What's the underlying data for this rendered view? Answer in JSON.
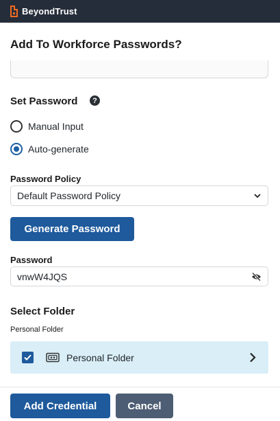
{
  "brand": {
    "name": "BeyondTrust",
    "logo_icon": "beyondtrust-logo-icon",
    "accent": "#f26b21"
  },
  "dialog": {
    "title": "Add To Workforce Passwords?"
  },
  "set_password": {
    "title": "Set Password",
    "help_icon": "?",
    "options": [
      {
        "label": "Manual Input",
        "selected": false
      },
      {
        "label": "Auto-generate",
        "selected": true
      }
    ]
  },
  "password_policy": {
    "label": "Password Policy",
    "selected": "Default Password Policy"
  },
  "generate_button": {
    "label": "Generate Password"
  },
  "password": {
    "label": "Password",
    "value": "vnwW4JQS"
  },
  "select_folder": {
    "title": "Select Folder",
    "sublabel": "Personal Folder",
    "items": [
      {
        "label": "Personal Folder",
        "checked": true
      }
    ]
  },
  "footer": {
    "add_label": "Add Credential",
    "cancel_label": "Cancel"
  },
  "colors": {
    "primary": "#1e5a9c",
    "secondary": "#4d5d73",
    "topbar": "#262d3a",
    "folder_bg": "#d9eef7"
  }
}
